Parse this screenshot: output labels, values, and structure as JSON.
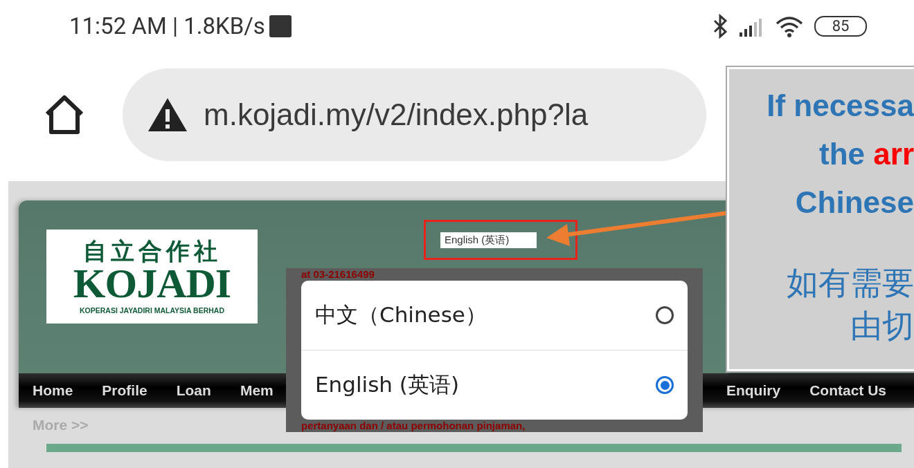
{
  "status_bar": {
    "time": "11:52 AM | 1.8KB/s",
    "battery": "85"
  },
  "address_bar": {
    "url": "m.kojadi.my/v2/index.php?la"
  },
  "site": {
    "logo": {
      "chinese": "自立合作社",
      "name": "KOJADI",
      "tagline": "KOPERASI JAYADIRI MALAYSIA BERHAD"
    },
    "language_select": {
      "value": "English (英语)"
    },
    "nav": [
      {
        "label": "Home"
      },
      {
        "label": "Profile"
      },
      {
        "label": "Loan"
      },
      {
        "label": "Mem"
      },
      {
        "label": "Enquiry"
      },
      {
        "label": "Contact Us"
      }
    ],
    "more_link": "More >>",
    "background_text": [
      "at 03-21616499",
      "pertanyaan dan / atau permohonan pinjaman,"
    ]
  },
  "language_dialog": {
    "options": [
      {
        "label": "中文（Chinese）",
        "selected": false
      },
      {
        "label": "English (英语)",
        "selected": true
      }
    ]
  },
  "callout": {
    "lines": [
      [
        {
          "text": "If necessa"
        }
      ],
      [
        {
          "text": "the "
        },
        {
          "text": "arr",
          "emphasis": true
        }
      ],
      [
        {
          "text": "Chinese"
        }
      ],
      [
        {
          "text": "如有需要"
        }
      ],
      [
        {
          "text": "由切"
        }
      ]
    ]
  }
}
